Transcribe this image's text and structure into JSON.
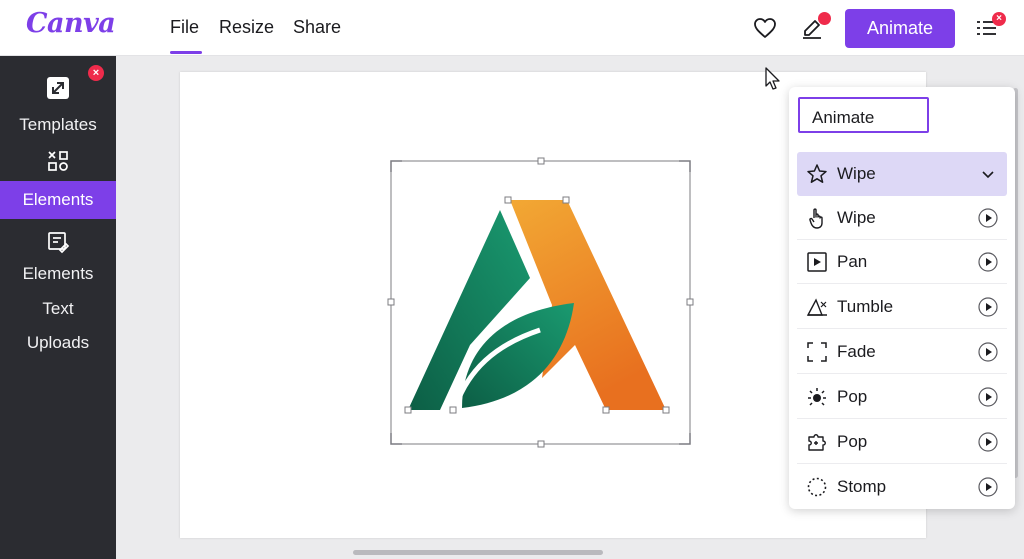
{
  "header": {
    "logo": "Canva",
    "menu": [
      "File",
      "Resize",
      "Share"
    ],
    "animate_button": "Animate",
    "heart_icon": "heart-icon",
    "pen_icon": "pen-icon",
    "list_icon": "list-icon"
  },
  "sidebar": {
    "items": [
      {
        "label": "Templates",
        "icon": "resize-arrow-icon"
      },
      {
        "label": "Elements",
        "icon": "elements-shapes-icon",
        "active": true
      },
      {
        "label": "Elements",
        "icon": "text-edit-icon"
      },
      {
        "label": "Text"
      },
      {
        "label": "Uploads"
      }
    ]
  },
  "panel": {
    "title": "Animate",
    "effects": [
      {
        "label": "Wipe",
        "icon": "star-icon",
        "selected": true
      },
      {
        "label": "Wipe",
        "icon": "hand-pointer-icon"
      },
      {
        "label": "Pan",
        "icon": "play-square-icon"
      },
      {
        "label": "Tumble",
        "icon": "tumble-icon"
      },
      {
        "label": "Fade",
        "icon": "fade-dashed-square-icon"
      },
      {
        "label": "Pop",
        "icon": "pop-burst-icon"
      },
      {
        "label": "Pop",
        "icon": "pop-puzzle-icon"
      },
      {
        "label": "Stomp",
        "icon": "stomp-dotted-circle-icon"
      }
    ]
  },
  "colors": {
    "accent": "#7d3fe8",
    "sidebar_bg": "#2b2c31",
    "badge": "#ef2b4b",
    "logo_green": "#0e7a5a",
    "logo_orange": "#f0982a"
  }
}
